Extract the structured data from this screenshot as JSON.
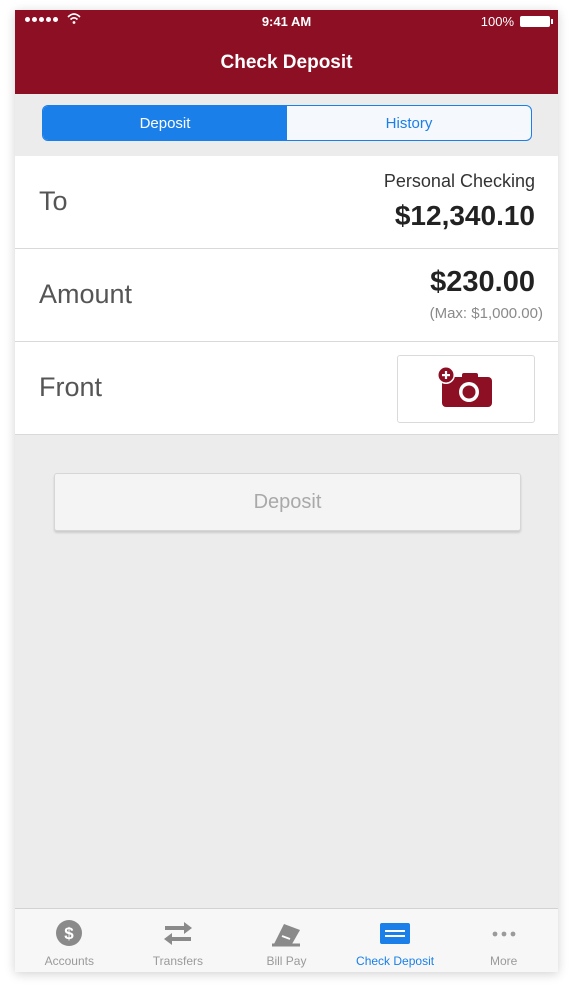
{
  "status_bar": {
    "time": "9:41 AM",
    "battery": "100%"
  },
  "nav": {
    "title": "Check Deposit"
  },
  "segments": [
    {
      "label": "Deposit",
      "active": true
    },
    {
      "label": "History",
      "active": false
    }
  ],
  "to_row": {
    "label": "To",
    "account": "Personal Checking",
    "balance": "$12,340.10"
  },
  "amount_row": {
    "label": "Amount",
    "value": "$230.00",
    "max": "(Max: $1,000.00)"
  },
  "front_row": {
    "label": "Front",
    "icon": "add-camera-icon"
  },
  "deposit_button": {
    "label": "Deposit"
  },
  "tabs": [
    {
      "label": "Accounts",
      "icon": "dollar-circle-icon",
      "active": false
    },
    {
      "label": "Transfers",
      "icon": "transfer-arrows-icon",
      "active": false
    },
    {
      "label": "Bill Pay",
      "icon": "bill-pay-icon",
      "active": false
    },
    {
      "label": "Check Deposit",
      "icon": "check-deposit-icon",
      "active": true
    },
    {
      "label": "More",
      "icon": "more-dots-icon",
      "active": false
    }
  ],
  "colors": {
    "brand": "#8c0f24",
    "accent": "#1a7fe8",
    "background": "#ececec"
  }
}
